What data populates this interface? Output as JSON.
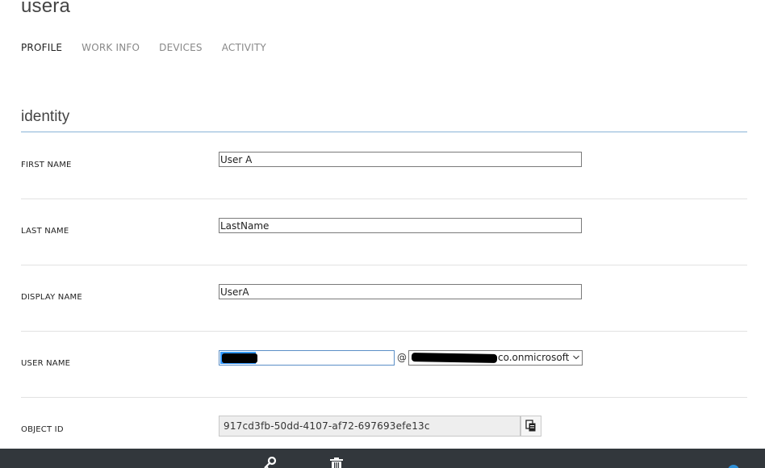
{
  "header": {
    "title": "usera"
  },
  "tabs": [
    {
      "label": "PROFILE",
      "active": true
    },
    {
      "label": "WORK INFO",
      "active": false
    },
    {
      "label": "DEVICES",
      "active": false
    },
    {
      "label": "ACTIVITY",
      "active": false
    }
  ],
  "identity": {
    "heading": "identity",
    "first_name_label": "FIRST NAME",
    "first_name_value": "User A",
    "last_name_label": "LAST NAME",
    "last_name_value": "LastName",
    "display_name_label": "DISPLAY NAME",
    "display_name_value": "UserA",
    "user_name_label": "USER NAME",
    "at_symbol": "@",
    "domain_visible_suffix": "co.onmicrosoft.c",
    "object_id_label": "OBJECT ID",
    "object_id_value": "917cd3fb-50dd-4107-af72-697693efe13c"
  },
  "command_bar": {
    "icons": [
      "key-icon",
      "delete-icon",
      "help-icon"
    ]
  },
  "colors": {
    "command_bar_bg": "#32373c",
    "section_underline": "#8ab4d8",
    "selection_blue": "#3399ff",
    "help_blue": "#2e8fd6"
  }
}
